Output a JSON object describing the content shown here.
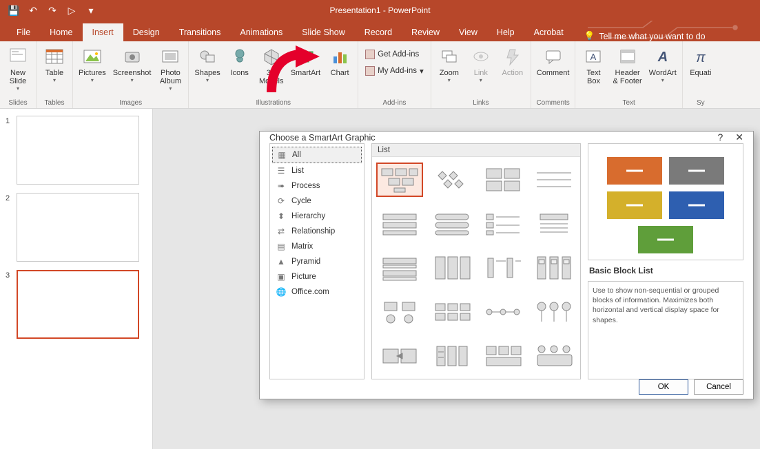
{
  "app_title": "Presentation1 - PowerPoint",
  "qat": {
    "save": "💾",
    "undo": "↶",
    "redo": "↷",
    "start": "▷",
    "more": "▾"
  },
  "tabs": [
    "File",
    "Home",
    "Insert",
    "Design",
    "Transitions",
    "Animations",
    "Slide Show",
    "Record",
    "Review",
    "View",
    "Help",
    "Acrobat"
  ],
  "tellme": {
    "label": "Tell me what you want to do"
  },
  "ribbon": {
    "slides": {
      "group": "Slides",
      "new_slide": "New\nSlide"
    },
    "tables": {
      "group": "Tables",
      "table": "Table"
    },
    "images": {
      "group": "Images",
      "pictures": "Pictures",
      "screenshot": "Screenshot",
      "photo_album": "Photo\nAlbum"
    },
    "illustrations": {
      "group": "Illustrations",
      "shapes": "Shapes",
      "icons": "Icons",
      "models3d": "3D\nModels",
      "smartart": "SmartArt",
      "chart": "Chart"
    },
    "addins": {
      "group": "Add-ins",
      "get": "Get Add-ins",
      "my": "My Add-ins"
    },
    "links": {
      "group": "Links",
      "zoom": "Zoom",
      "link": "Link",
      "action": "Action"
    },
    "comments": {
      "group": "Comments",
      "comment": "Comment"
    },
    "text": {
      "group": "Text",
      "textbox": "Text\nBox",
      "header": "Header\n& Footer",
      "wordart": "WordArt"
    },
    "symbols": {
      "group": "Sy",
      "equation": "Equati"
    }
  },
  "slides": [
    "1",
    "2",
    "3"
  ],
  "dialog": {
    "title": "Choose a SmartArt Graphic",
    "help": "?",
    "close": "✕",
    "categories": [
      "All",
      "List",
      "Process",
      "Cycle",
      "Hierarchy",
      "Relationship",
      "Matrix",
      "Pyramid",
      "Picture",
      "Office.com"
    ],
    "list_header": "List",
    "preview_title": "Basic Block List",
    "preview_desc": "Use to show non-sequential or grouped blocks of information. Maximizes both horizontal and vertical display space for shapes.",
    "ok": "OK",
    "cancel": "Cancel",
    "preview_colors": [
      "#d86c2e",
      "#7a7a7a",
      "#d4b02b",
      "#2e5fb0",
      "#5f9e3a"
    ]
  }
}
